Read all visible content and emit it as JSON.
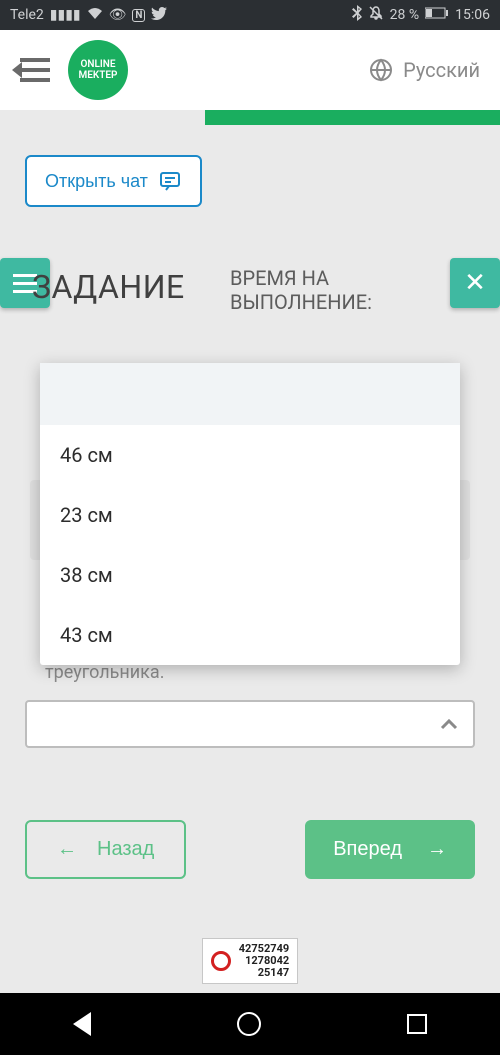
{
  "status": {
    "carrier": "Tele2",
    "battery_pct": "28 %",
    "time": "15:06"
  },
  "header": {
    "logo_line1": "ONLINE",
    "logo_line2": "MEKTEP",
    "language": "Русский"
  },
  "chat_button": "Открыть чат",
  "task": {
    "title": "ЗАДАНИЕ",
    "sub_line1": "ВРЕМЯ НА",
    "sub_line2": "ВЫПОЛНЕНИЕ:"
  },
  "dropdown": {
    "options": [
      "46 см",
      "23 см",
      "38 см",
      "43 см"
    ]
  },
  "truncated": "треугольника.",
  "nav": {
    "back": "Назад",
    "forward": "Вперед"
  },
  "footer_numbers": [
    "42752749",
    "1278042",
    "25147"
  ]
}
